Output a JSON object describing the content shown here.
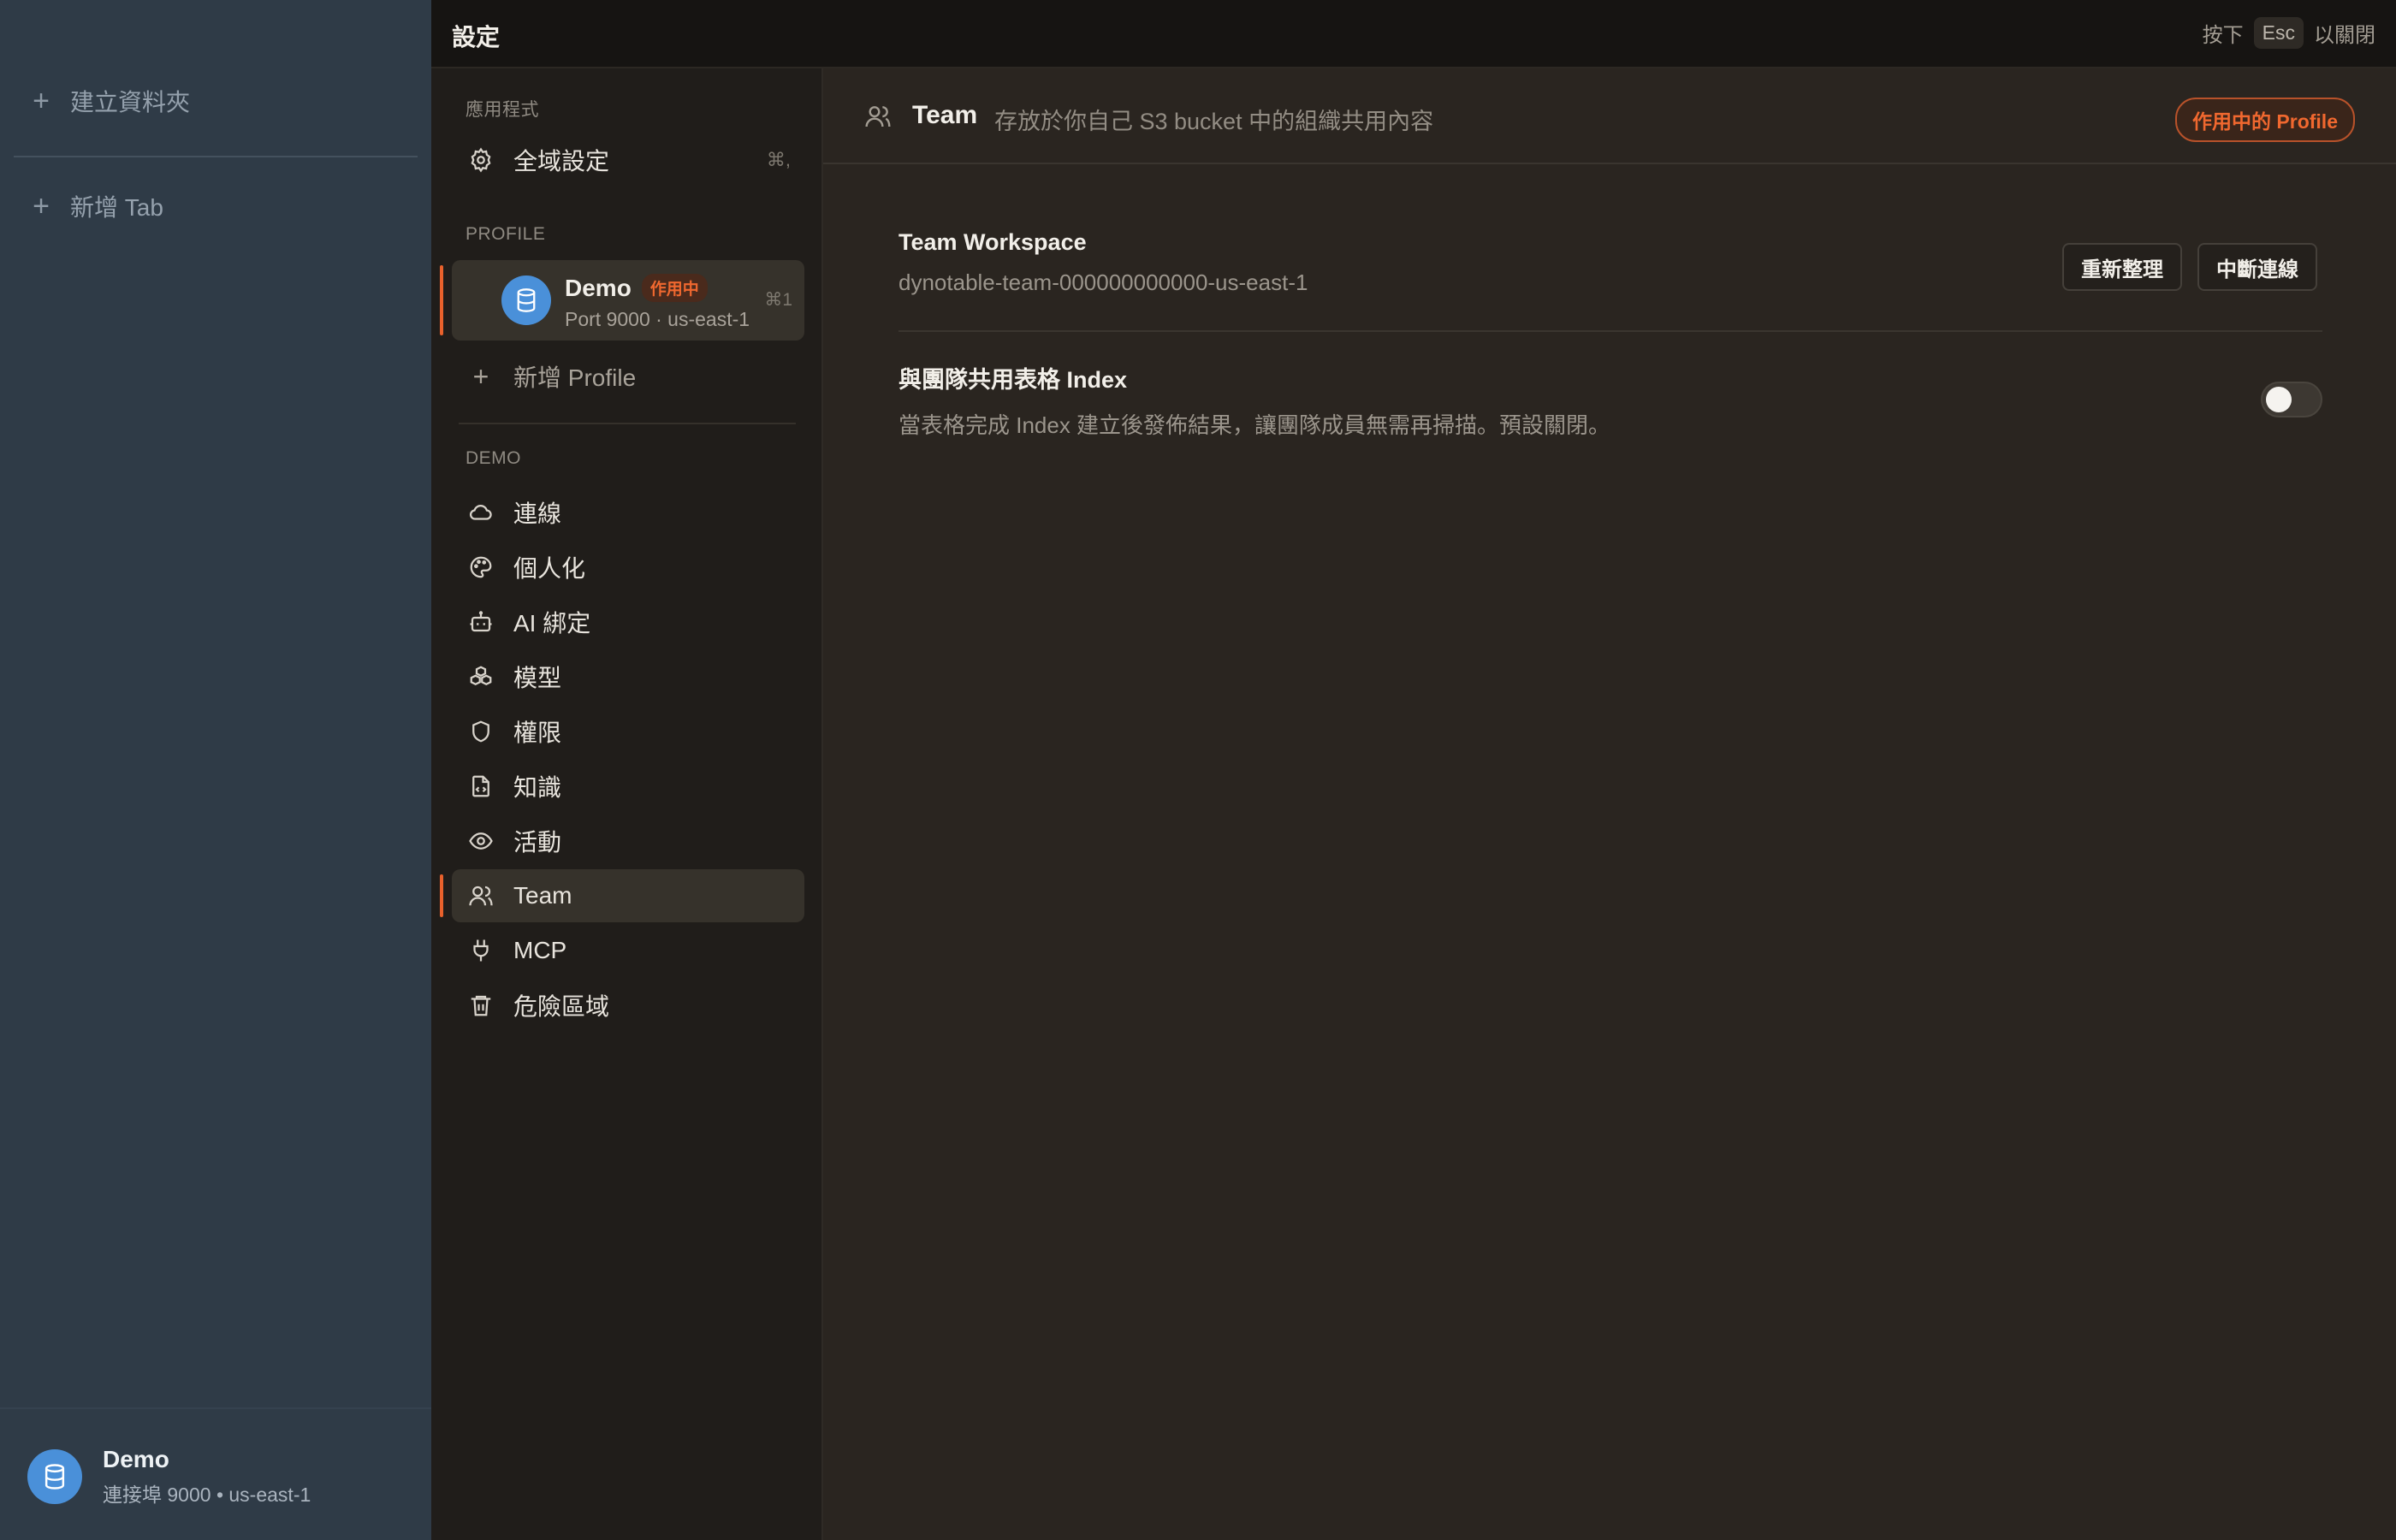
{
  "app_sidebar": {
    "create_folder": "建立資料夾",
    "new_tab": "新增 Tab",
    "footer": {
      "name": "Demo",
      "sub": "連接埠 9000 • us-east-1"
    }
  },
  "topbar": {
    "title": "設定",
    "hint_prefix": "按下",
    "hint_key": "Esc",
    "hint_suffix": "以關閉"
  },
  "nav": {
    "app_section": "應用程式",
    "global_settings": {
      "label": "全域設定",
      "shortcut": "⌘,"
    },
    "profile_section": "PROFILE",
    "profile": {
      "name": "Demo",
      "badge": "作用中",
      "sub": "Port 9000 · us-east-1",
      "shortcut": "⌘1"
    },
    "add_profile": "新增 Profile",
    "demo_section": "DEMO",
    "items": [
      {
        "label": "連線",
        "icon": "cloud-icon"
      },
      {
        "label": "個人化",
        "icon": "palette-icon"
      },
      {
        "label": "AI 綁定",
        "icon": "bot-icon"
      },
      {
        "label": "模型",
        "icon": "boxes-icon"
      },
      {
        "label": "權限",
        "icon": "shield-icon"
      },
      {
        "label": "知識",
        "icon": "file-code-icon"
      },
      {
        "label": "活動",
        "icon": "eye-icon"
      },
      {
        "label": "Team",
        "icon": "users-icon",
        "active": true
      },
      {
        "label": "MCP",
        "icon": "plug-icon"
      },
      {
        "label": "危險區域",
        "icon": "trash-icon"
      }
    ]
  },
  "main": {
    "title": "Team",
    "description": "存放於你自己 S3 bucket 中的組織共用內容",
    "active_profile_badge": "作用中的 Profile",
    "workspace": {
      "title": "Team Workspace",
      "value": "dynotable-team-000000000000-us-east-1",
      "refresh_label": "重新整理",
      "disconnect_label": "中斷連線"
    },
    "share_index": {
      "title": "與團隊共用表格 Index",
      "description": "當表格完成 Index 建立後發佈結果，讓團隊成員無需再掃描。預設關閉。",
      "enabled": false
    }
  }
}
